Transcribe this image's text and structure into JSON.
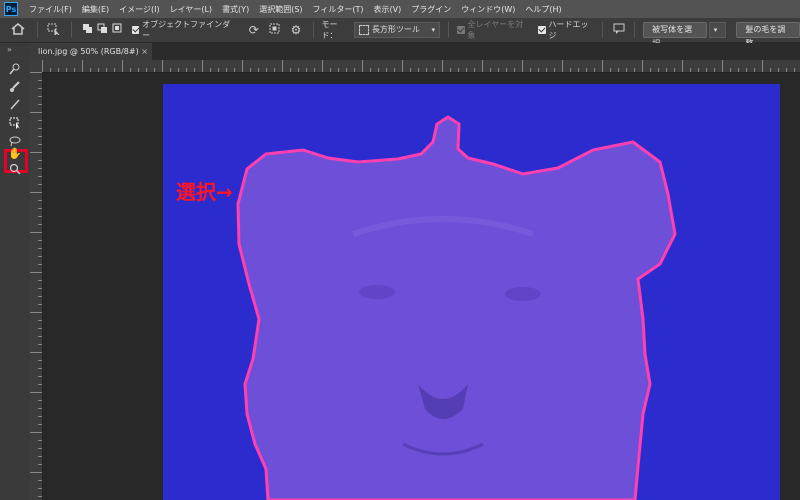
{
  "app": {
    "logo": "Ps"
  },
  "menu": [
    "ファイル(F)",
    "編集(E)",
    "イメージ(I)",
    "レイヤー(L)",
    "書式(Y)",
    "選択範囲(S)",
    "フィルター(T)",
    "表示(V)",
    "プラグイン",
    "ウィンドウ(W)",
    "ヘルプ(H)"
  ],
  "options": {
    "object_finder_label": "オブジェクトファインダー",
    "mode_label": "モード：",
    "mode_value": "長方形ツール",
    "sample_all_layers": "全レイヤーを対象",
    "hard_edge": "ハードエッジ",
    "select_subject": "被写体を選択",
    "refine_hair": "髪の毛を調整"
  },
  "document": {
    "tab_title": "lion.jpg @ 50% (RGB/8#)",
    "close": "×"
  },
  "annotation": {
    "text": "選択→",
    "color": "#ff1428"
  },
  "icons": {
    "home": "home-icon",
    "tools": [
      "quick-selection-icon",
      "brush-icon",
      "pencil-icon",
      "object-selection-icon",
      "lasso-icon",
      "hand-icon",
      "zoom-icon"
    ]
  },
  "colors": {
    "image_overlay": "#2a2acc",
    "subject_tint": "#6e4fd8",
    "selection_edge": "#ff40b0",
    "highlight_box": "#e4002b"
  }
}
